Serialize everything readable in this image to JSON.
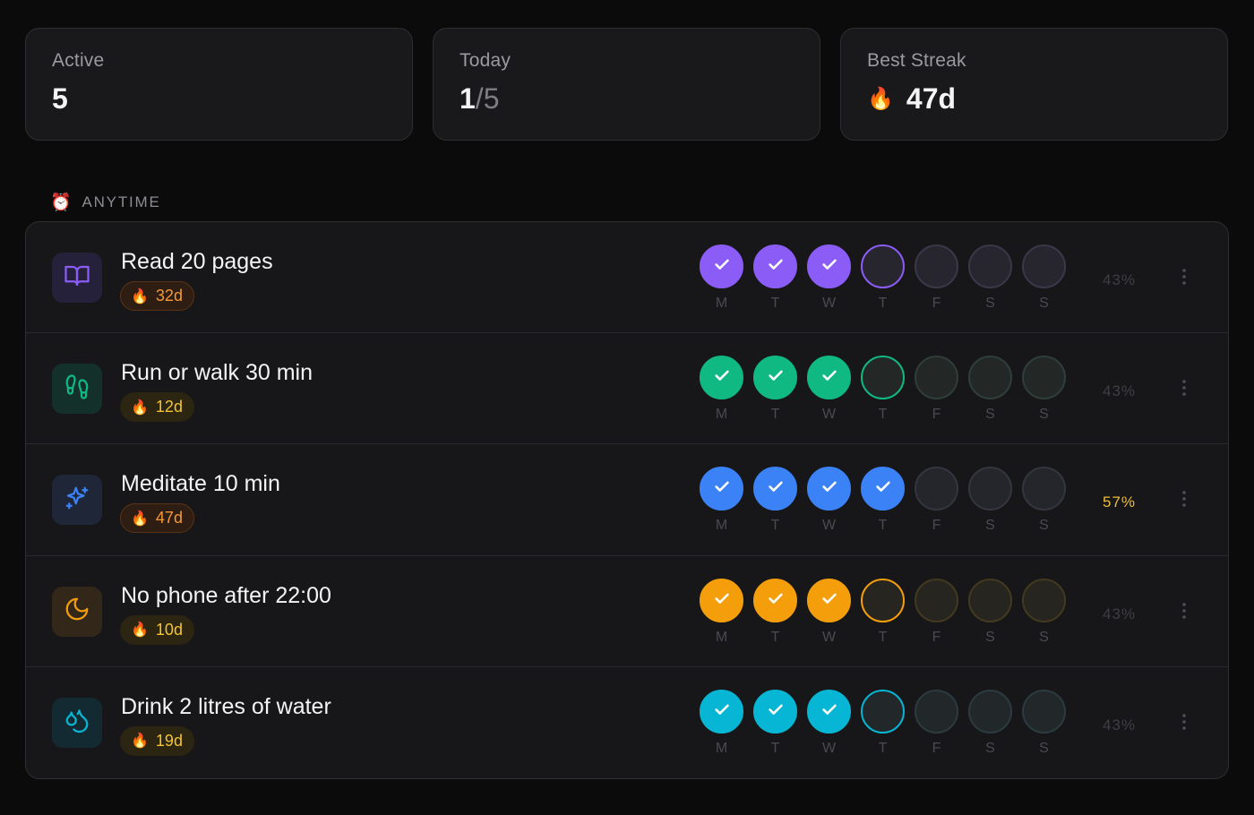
{
  "stats": [
    {
      "label": "Active",
      "value": "5"
    },
    {
      "label": "Today",
      "value_done": "1",
      "value_total": "/5"
    },
    {
      "label": "Best Streak",
      "icon": "fire-icon",
      "value": "47d"
    }
  ],
  "section": {
    "icon": "alarm-clock-icon",
    "title": "ANYTIME"
  },
  "day_letters": [
    "M",
    "T",
    "W",
    "T",
    "F",
    "S",
    "S"
  ],
  "habits": [
    {
      "name": "Read 20 pages",
      "icon": "book-open-icon",
      "streak": "32d",
      "accent": "#8b5cf6",
      "icon_bg": "#25213a",
      "pill_bg": "#2e1d12",
      "pill_border": "#5a3418",
      "pill_text": "#f59a33",
      "ring_fill": "#27262f",
      "ring_border": "#3a3848",
      "days": [
        "done",
        "done",
        "done",
        "today",
        "none",
        "none",
        "none"
      ],
      "percent": "43%",
      "percent_high": false
    },
    {
      "name": "Run or walk 30 min",
      "icon": "footprints-icon",
      "streak": "12d",
      "accent": "#10b981",
      "icon_bg": "#14302a",
      "pill_bg": "#2b2512",
      "pill_border": "#2b2512",
      "pill_text": "#f4c431",
      "ring_fill": "#232826",
      "ring_border": "#2f3e38",
      "days": [
        "done",
        "done",
        "done",
        "today",
        "none",
        "none",
        "none"
      ],
      "percent": "43%",
      "percent_high": false
    },
    {
      "name": "Meditate 10 min",
      "icon": "sparkles-icon",
      "streak": "47d",
      "accent": "#3b82f6",
      "icon_bg": "#1e2638",
      "pill_bg": "#2e1d12",
      "pill_border": "#5a3418",
      "pill_text": "#f59a33",
      "ring_fill": "#25262b",
      "ring_border": "#33363f",
      "days": [
        "done",
        "done",
        "done",
        "done",
        "none",
        "none",
        "none"
      ],
      "percent": "57%",
      "percent_high": true
    },
    {
      "name": "No phone after 22:00",
      "icon": "moon-icon",
      "streak": "10d",
      "accent": "#f59e0b",
      "icon_bg": "#33271a",
      "pill_bg": "#2b2512",
      "pill_border": "#2b2512",
      "pill_text": "#f4c431",
      "ring_fill": "#27251f",
      "ring_border": "#43391f",
      "days": [
        "done",
        "done",
        "done",
        "today",
        "none",
        "none",
        "none"
      ],
      "percent": "43%",
      "percent_high": false
    },
    {
      "name": "Drink 2 litres of water",
      "icon": "droplets-icon",
      "streak": "19d",
      "accent": "#06b6d4",
      "icon_bg": "#132a32",
      "pill_bg": "#2b2512",
      "pill_border": "#2b2512",
      "pill_text": "#f4c431",
      "ring_fill": "#222729",
      "ring_border": "#2b3b40",
      "days": [
        "done",
        "done",
        "done",
        "today",
        "none",
        "none",
        "none"
      ],
      "percent": "43%",
      "percent_high": false
    }
  ]
}
